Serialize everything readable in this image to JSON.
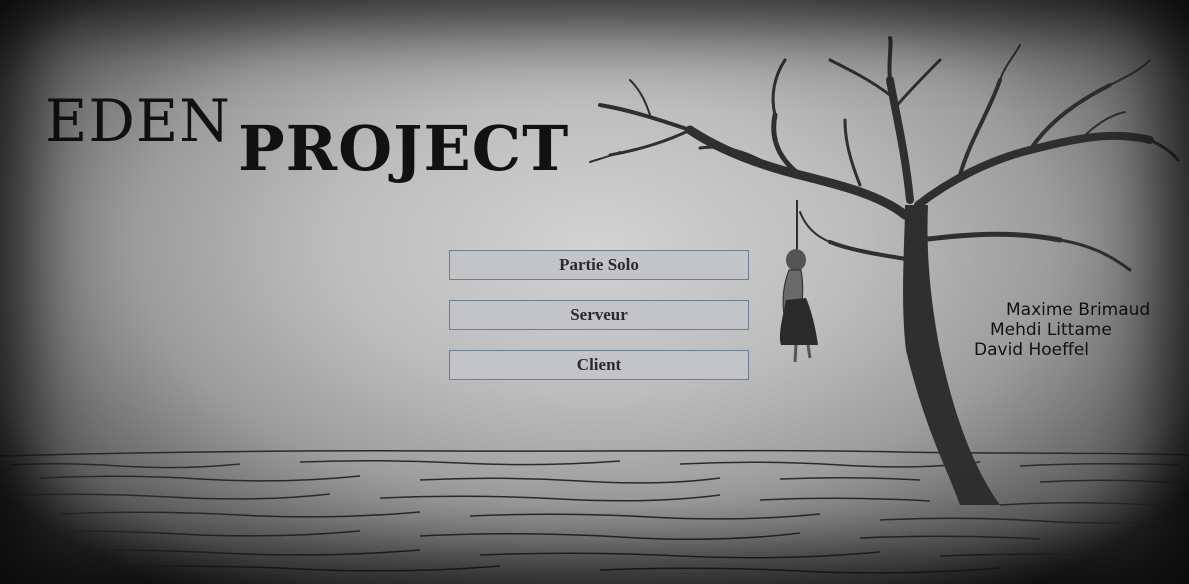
{
  "title": {
    "part1": "EDEN",
    "part2": "PROJECT"
  },
  "menu": {
    "buttons": [
      {
        "label": "Partie Solo"
      },
      {
        "label": "Serveur"
      },
      {
        "label": "Client"
      }
    ]
  },
  "credits": [
    "Maxime Brimaud",
    "Mehdi Littame",
    "David Hoeffel"
  ],
  "colors": {
    "button_bg": "#c3c4c8",
    "button_border": "#6d7d91",
    "ink": "#2f2f2f"
  }
}
